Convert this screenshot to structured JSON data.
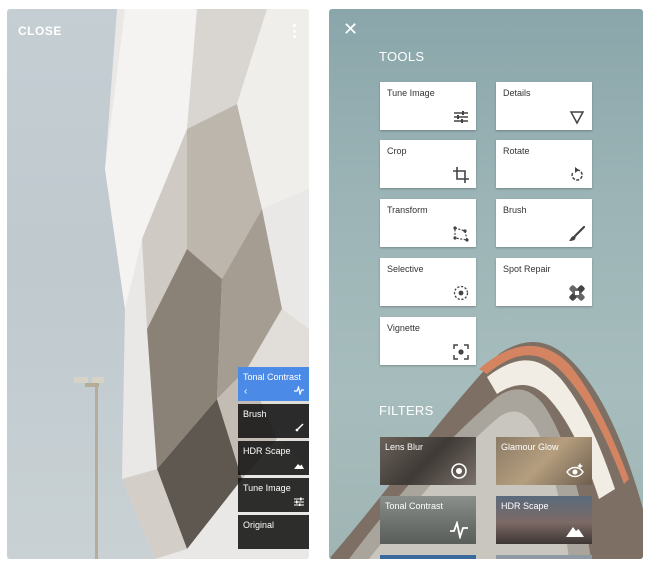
{
  "editor": {
    "close_label": "CLOSE",
    "more_icon": "kebab-menu-icon",
    "history": [
      {
        "label": "Tonal Contrast",
        "icon": "tonal-contrast-icon",
        "active": true
      },
      {
        "label": "Brush",
        "icon": "brush-icon"
      },
      {
        "label": "HDR Scape",
        "icon": "hdr-scape-icon"
      },
      {
        "label": "Tune Image",
        "icon": "tune-image-icon"
      },
      {
        "label": "Original",
        "icon": ""
      }
    ],
    "back_glyph": "‹"
  },
  "tools_panel": {
    "close_glyph": "✕",
    "tools_title": "TOOLS",
    "tools": [
      {
        "label": "Tune Image",
        "icon": "tune-icon"
      },
      {
        "label": "Details",
        "icon": "details-triangle-icon"
      },
      {
        "label": "Crop",
        "icon": "crop-icon"
      },
      {
        "label": "Rotate",
        "icon": "rotate-icon"
      },
      {
        "label": "Transform",
        "icon": "transform-icon"
      },
      {
        "label": "Brush",
        "icon": "brush-icon"
      },
      {
        "label": "Selective",
        "icon": "selective-icon"
      },
      {
        "label": "Spot Repair",
        "icon": "bandage-icon"
      },
      {
        "label": "Vignette",
        "icon": "vignette-icon"
      }
    ],
    "filters_title": "FILTERS",
    "filters": [
      {
        "label": "Lens Blur",
        "icon": "lens-blur-icon"
      },
      {
        "label": "Glamour Glow",
        "icon": "eye-sparkle-icon"
      },
      {
        "label": "Tonal Contrast",
        "icon": "tonal-contrast-icon"
      },
      {
        "label": "HDR Scape",
        "icon": "mountain-icon"
      }
    ]
  },
  "colors": {
    "accent": "#4c8ae8",
    "card": "#ffffff",
    "history_bg": "#121212"
  }
}
